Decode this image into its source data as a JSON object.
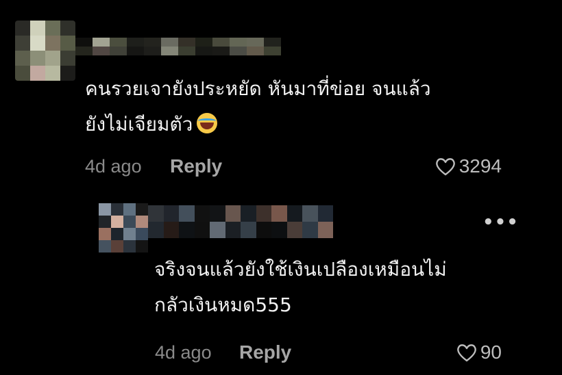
{
  "comments": [
    {
      "lines": [
        "คนรวยเจายังประหยัด หันมาที่ข่อย จนแล้ว",
        "ยังไม่เจียมตัว"
      ],
      "emoji": "laughing-tears-emoji",
      "age": "4d ago",
      "reply_label": "Reply",
      "likes": "3294"
    },
    {
      "lines": [
        "จริงจนแล้วยังใช้เงินเปลืองเหมือนไม่",
        "กลัวเงินหมด555"
      ],
      "more_label": "•••",
      "age": "4d ago",
      "reply_label": "Reply",
      "likes": "90"
    }
  ],
  "colors": {
    "background": "#000000",
    "text": "#f2f2f2",
    "meta": "#8a8a8a",
    "reply": "#a6a6a6"
  },
  "mosaic_palette_1": [
    "#3b3d33",
    "#6a6e58",
    "#8c8f78",
    "#2a2a26",
    "#575b46",
    "#b7b9a0",
    "#d8dac6",
    "#4a4c3c",
    "#2f302a",
    "#a1a38b",
    "#cfd1bb",
    "#5d5f4d",
    "#1c1c1a",
    "#7d7360",
    "#c2a9a0",
    "#3e3f36"
  ],
  "mosaic_palette_2": [
    "#3a4a5c",
    "#5f7080",
    "#1d242c",
    "#8a96a4",
    "#b08a7c",
    "#2b333c",
    "#d4b0a0",
    "#45525f",
    "#1a1a1a",
    "#70808f",
    "#2a3038",
    "#9a7060",
    "#141414",
    "#3c4a58",
    "#5a4038",
    "#202428"
  ]
}
